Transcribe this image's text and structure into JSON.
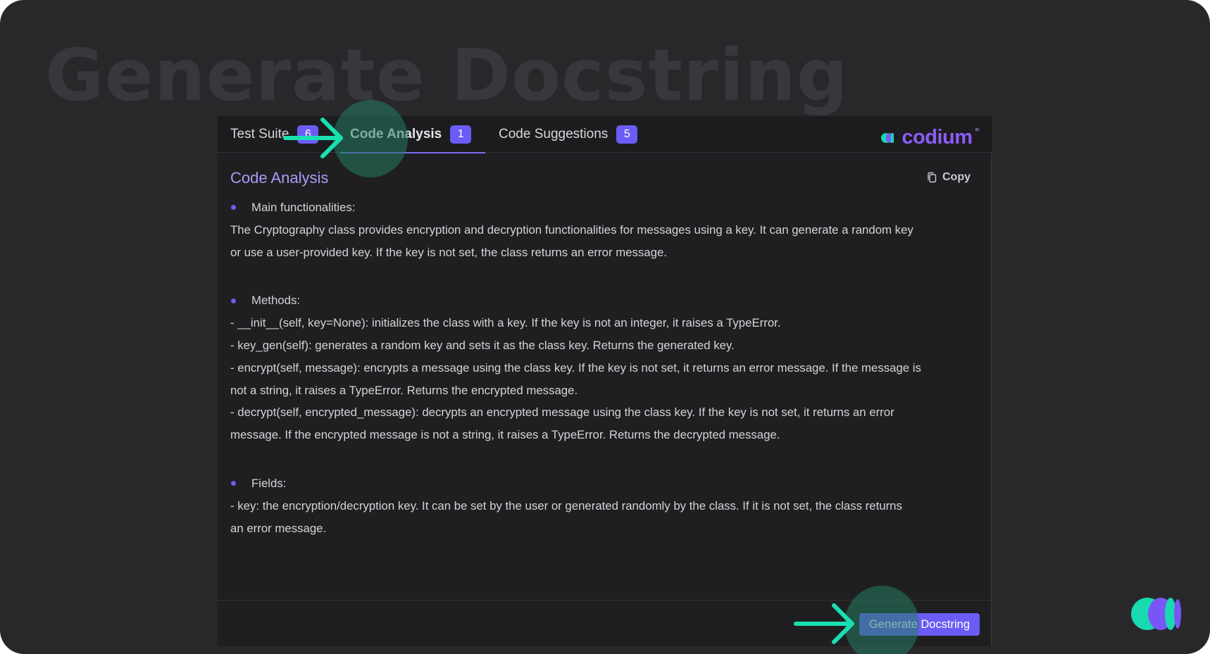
{
  "hero": {
    "title": "Generate Docstring"
  },
  "tabs": [
    {
      "label": "Test Suite",
      "count": "6"
    },
    {
      "label": "Code Analysis",
      "count": "1"
    },
    {
      "label": "Code Suggestions",
      "count": "5"
    }
  ],
  "brand": {
    "name": "codium",
    "tm": "ai"
  },
  "section": {
    "title": "Code Analysis",
    "copy_label": "Copy"
  },
  "analysis": {
    "main_heading": "Main functionalities:",
    "main_lines": [
      "The Cryptography class provides encryption and decryption functionalities for messages using a key. It can generate a random key",
      "or use a user-provided key. If the key is not set, the class returns an error message."
    ],
    "methods_heading": "Methods:",
    "methods_lines": [
      "- __init__(self, key=None): initializes the class with a key. If the key is not an integer, it raises a TypeError.",
      "- key_gen(self): generates a random key and sets it as the class key. Returns the generated key.",
      "- encrypt(self, message): encrypts a message using the class key. If the key is not set, it returns an error message. If the message is",
      "not a string, it raises a TypeError. Returns the encrypted message.",
      "- decrypt(self, encrypted_message): decrypts an encrypted message using the class key. If the key is not set, it returns an error",
      "message. If the encrypted message is not a string, it raises a TypeError. Returns the decrypted message."
    ],
    "fields_heading": "Fields:",
    "fields_lines": [
      "- key: the encryption/decryption key. It can be set by the user or generated randomly by the class. If it is not set, the class returns",
      "an error message."
    ]
  },
  "footer": {
    "button_label": "Generate Docstring"
  },
  "colors": {
    "accent": "#6a5cf5",
    "arrow": "#19e0b0",
    "spotlight": "#227c62",
    "background": "#28282b"
  },
  "icons": {
    "copy": "copy-icon",
    "arrow": "arrow-right-icon",
    "logo": "codium-logo-icon"
  }
}
